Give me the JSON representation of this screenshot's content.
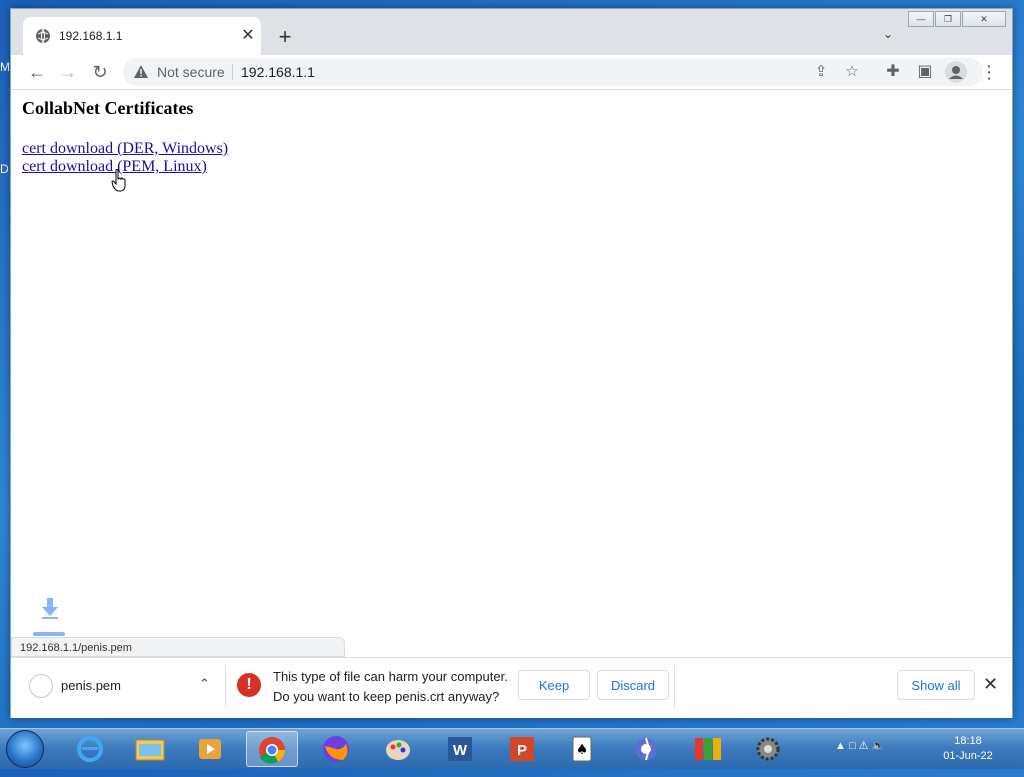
{
  "desktop": {
    "label1": "M",
    "label2": "D"
  },
  "window": {
    "controls": {
      "minimize": "—",
      "restore": "❐",
      "close": "✕"
    }
  },
  "tab": {
    "title": "192.168.1.1",
    "close": "✕",
    "new_tab": "+",
    "tab_search": "⌄"
  },
  "toolbar": {
    "back": "←",
    "forward": "→",
    "reload": "↻",
    "security": "Not secure",
    "url": "192.168.1.1",
    "icons": [
      "share-icon",
      "star-icon",
      "extensions-icon",
      "side-panel-icon",
      "profile-icon",
      "menu-icon"
    ]
  },
  "page": {
    "title": "CollabNet Certificates",
    "links": [
      "cert download (DER, Windows)",
      "cert download (PEM, Linux)"
    ]
  },
  "status_bar": {
    "url": "192.168.1.1/penis.pem"
  },
  "download_shelf": {
    "file_name": "penis.pem",
    "warning_line1": "This type of file can harm your computer.",
    "warning_line2": "Do you want to keep penis.crt anyway?",
    "keep": "Keep",
    "discard": "Discard",
    "show_all": "Show all",
    "close": "✕"
  },
  "taskbar": {
    "apps": [
      "ie-icon",
      "explorer-icon",
      "media-player-icon",
      "chrome-icon",
      "firefox-icon",
      "paint-icon",
      "word-icon",
      "powerpoint-icon",
      "solitaire-icon",
      "app-icon",
      "avg-icon",
      "settings-icon"
    ],
    "clock_time": "18:18",
    "clock_date": "01-Jun-22"
  },
  "colors": {
    "link": "#1a0dab",
    "accent": "#1a73e8",
    "danger": "#d93025"
  }
}
